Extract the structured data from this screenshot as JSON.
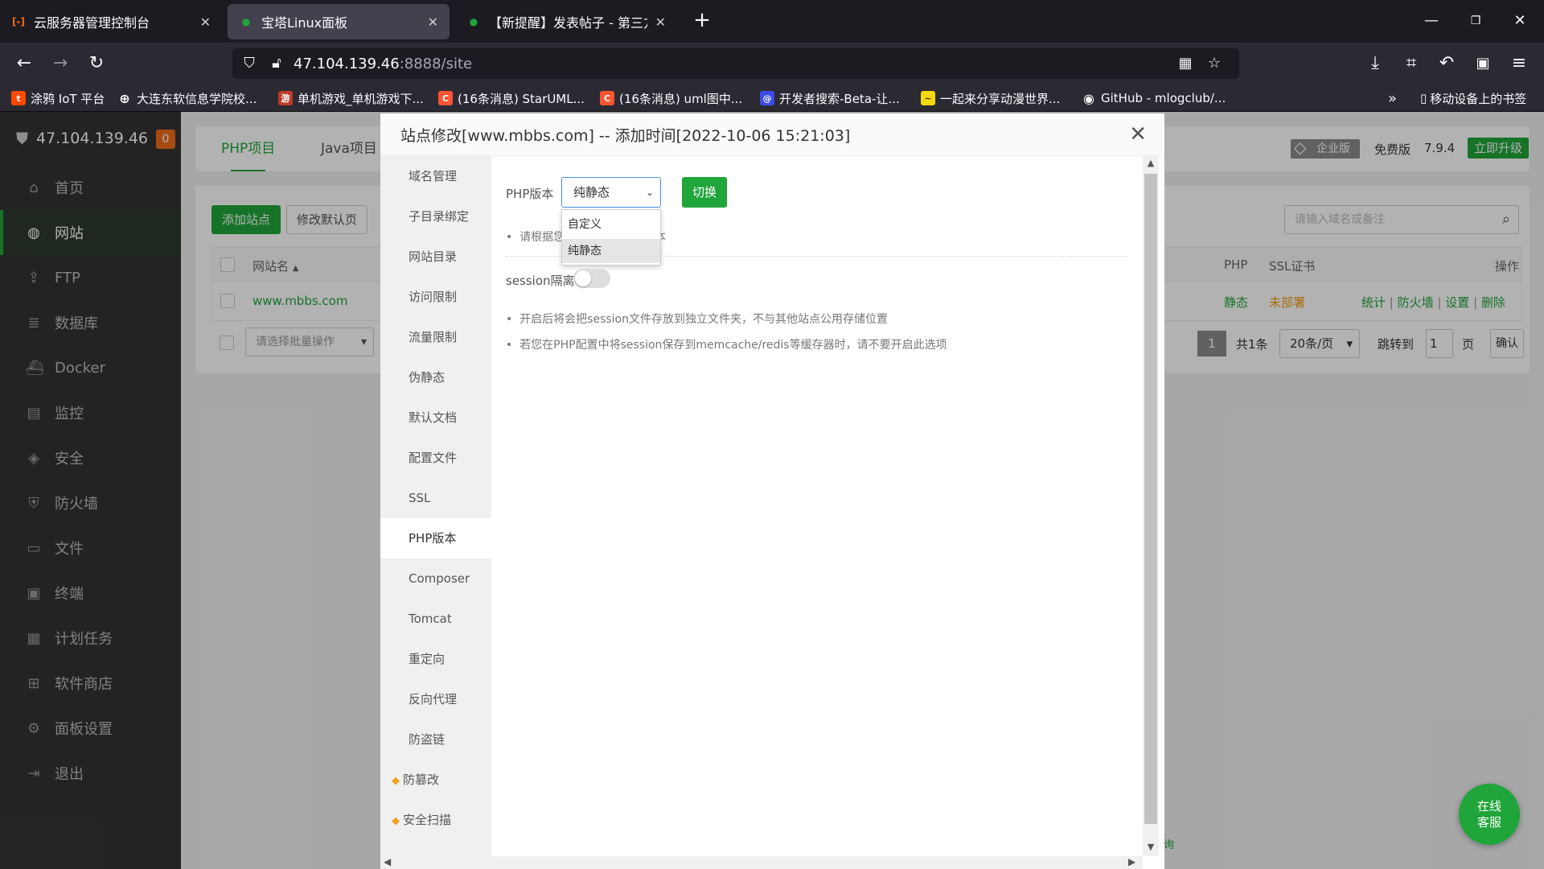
{
  "browser": {
    "tabs": [
      {
        "title": "云服务器管理控制台",
        "favicon": "[-]",
        "color": "#ff6a00"
      },
      {
        "title": "宝塔Linux面板",
        "favicon": "●",
        "color": "#20a53a"
      },
      {
        "title": "【新提醒】发表帖子 - 第三方应",
        "favicon": "●",
        "color": "#20a53a"
      }
    ],
    "url_host": "47.104.139.46",
    "url_rest": ":8888/site",
    "bookmarks": [
      {
        "label": "涂鸦 IoT 平台",
        "color": "#ff4800",
        "glyph": "t"
      },
      {
        "label": "大连东软信息学院校...",
        "color": "#2b2a33",
        "glyph": "⊕"
      },
      {
        "label": "单机游戏_单机游戏下...",
        "color": "#c0392b",
        "glyph": "游"
      },
      {
        "label": "(16条消息) StarUML...",
        "color": "#fc5531",
        "glyph": "C"
      },
      {
        "label": "(16条消息) uml图中...",
        "color": "#fc5531",
        "glyph": "C"
      },
      {
        "label": "开发者搜索-Beta-让...",
        "color": "#3c4bf0",
        "glyph": "@"
      },
      {
        "label": "一起来分享动漫世界...",
        "color": "#f5d90a",
        "glyph": "~"
      },
      {
        "label": "GitHub - mlogclub/...",
        "color": "#2b2a33",
        "glyph": "◉"
      }
    ],
    "mobile_bookmarks": "移动设备上的书签"
  },
  "sidebar": {
    "server_ip": "47.104.139.46",
    "badge": "0",
    "items": [
      {
        "label": "首页",
        "icon": "⌂"
      },
      {
        "label": "网站",
        "icon": "◍"
      },
      {
        "label": "FTP",
        "icon": "⇪"
      },
      {
        "label": "数据库",
        "icon": "≣"
      },
      {
        "label": "Docker",
        "icon": "⛴"
      },
      {
        "label": "监控",
        "icon": "▤"
      },
      {
        "label": "安全",
        "icon": "◈"
      },
      {
        "label": "防火墙",
        "icon": "⛨"
      },
      {
        "label": "文件",
        "icon": "▭"
      },
      {
        "label": "终端",
        "icon": "▣"
      },
      {
        "label": "计划任务",
        "icon": "▦"
      },
      {
        "label": "软件商店",
        "icon": "⊞"
      },
      {
        "label": "面板设置",
        "icon": "⚙"
      },
      {
        "label": "退出",
        "icon": "⇥"
      }
    ]
  },
  "main": {
    "tabs": [
      "PHP项目",
      "Java项目"
    ],
    "enterprise": "企业版",
    "free_version": "免费版",
    "version": "7.9.4",
    "upgrade": "立即升级",
    "add_site": "添加站点",
    "modify_default": "修改默认页",
    "search_placeholder": "请输入域名或备注",
    "col_site_name": "网站名",
    "col_php": "PHP",
    "col_ssl": "SSL证书",
    "col_ops": "操作",
    "row": {
      "site": "www.mbbs.com",
      "php": "静态",
      "ssl": "未部署",
      "ops": [
        "统计",
        "防火墙",
        "设置",
        "删除"
      ]
    },
    "batch_placeholder": "请选择批量操作",
    "pagination": {
      "page": "1",
      "total": "共1条",
      "per_page": "20条/页",
      "jump": "跳转到",
      "jump_value": "1",
      "page_unit": "页",
      "confirm": "确认"
    },
    "footer_glyph": "询"
  },
  "modal": {
    "title": "站点修改[www.mbbs.com] -- 添加时间[2022-10-06 15:21:03]",
    "nav": [
      {
        "label": "域名管理"
      },
      {
        "label": "子目录绑定"
      },
      {
        "label": "网站目录"
      },
      {
        "label": "访问限制"
      },
      {
        "label": "流量限制"
      },
      {
        "label": "伪静态"
      },
      {
        "label": "默认文档"
      },
      {
        "label": "配置文件"
      },
      {
        "label": "SSL"
      },
      {
        "label": "PHP版本"
      },
      {
        "label": "Composer"
      },
      {
        "label": "Tomcat"
      },
      {
        "label": "重定向"
      },
      {
        "label": "反向代理"
      },
      {
        "label": "防盗链"
      },
      {
        "label": "防篡改"
      },
      {
        "label": "安全扫描"
      }
    ],
    "php_label": "PHP版本",
    "php_selected": "纯静态",
    "switch_btn": "切换",
    "options": [
      "自定义",
      "纯静态"
    ],
    "hint_left": "请根据您",
    "hint_right": "本",
    "session_label": "session隔离",
    "session_hints": [
      "开启后将会把session文件存放到独立文件夹，不与其他站点公用存储位置",
      "若您在PHP配置中将session保存到memcache/redis等缓存器时，请不要开启此选项"
    ]
  },
  "service": {
    "line1": "在线",
    "line2": "客服"
  }
}
